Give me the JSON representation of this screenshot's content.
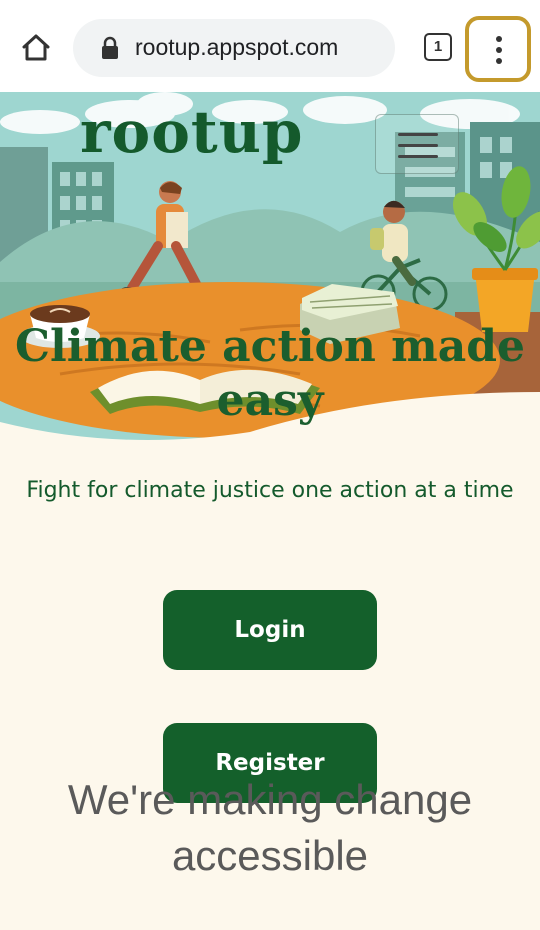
{
  "browser": {
    "url": "rootup.appspot.com",
    "tab_count": "1"
  },
  "site": {
    "logo": "rootup",
    "headline": "Climate action made easy",
    "tagline": "Fight for climate justice one action at a time",
    "login_label": "Login",
    "register_label": "Register",
    "subheading": "We're making change accessible"
  },
  "colors": {
    "brand_green": "#14602b",
    "background": "#fdf8ec",
    "menu_highlight": "#c49a2c"
  },
  "icons": [
    "home-icon",
    "lock-icon",
    "tab-switcher-icon",
    "more-vert-icon",
    "hamburger-menu-icon"
  ]
}
